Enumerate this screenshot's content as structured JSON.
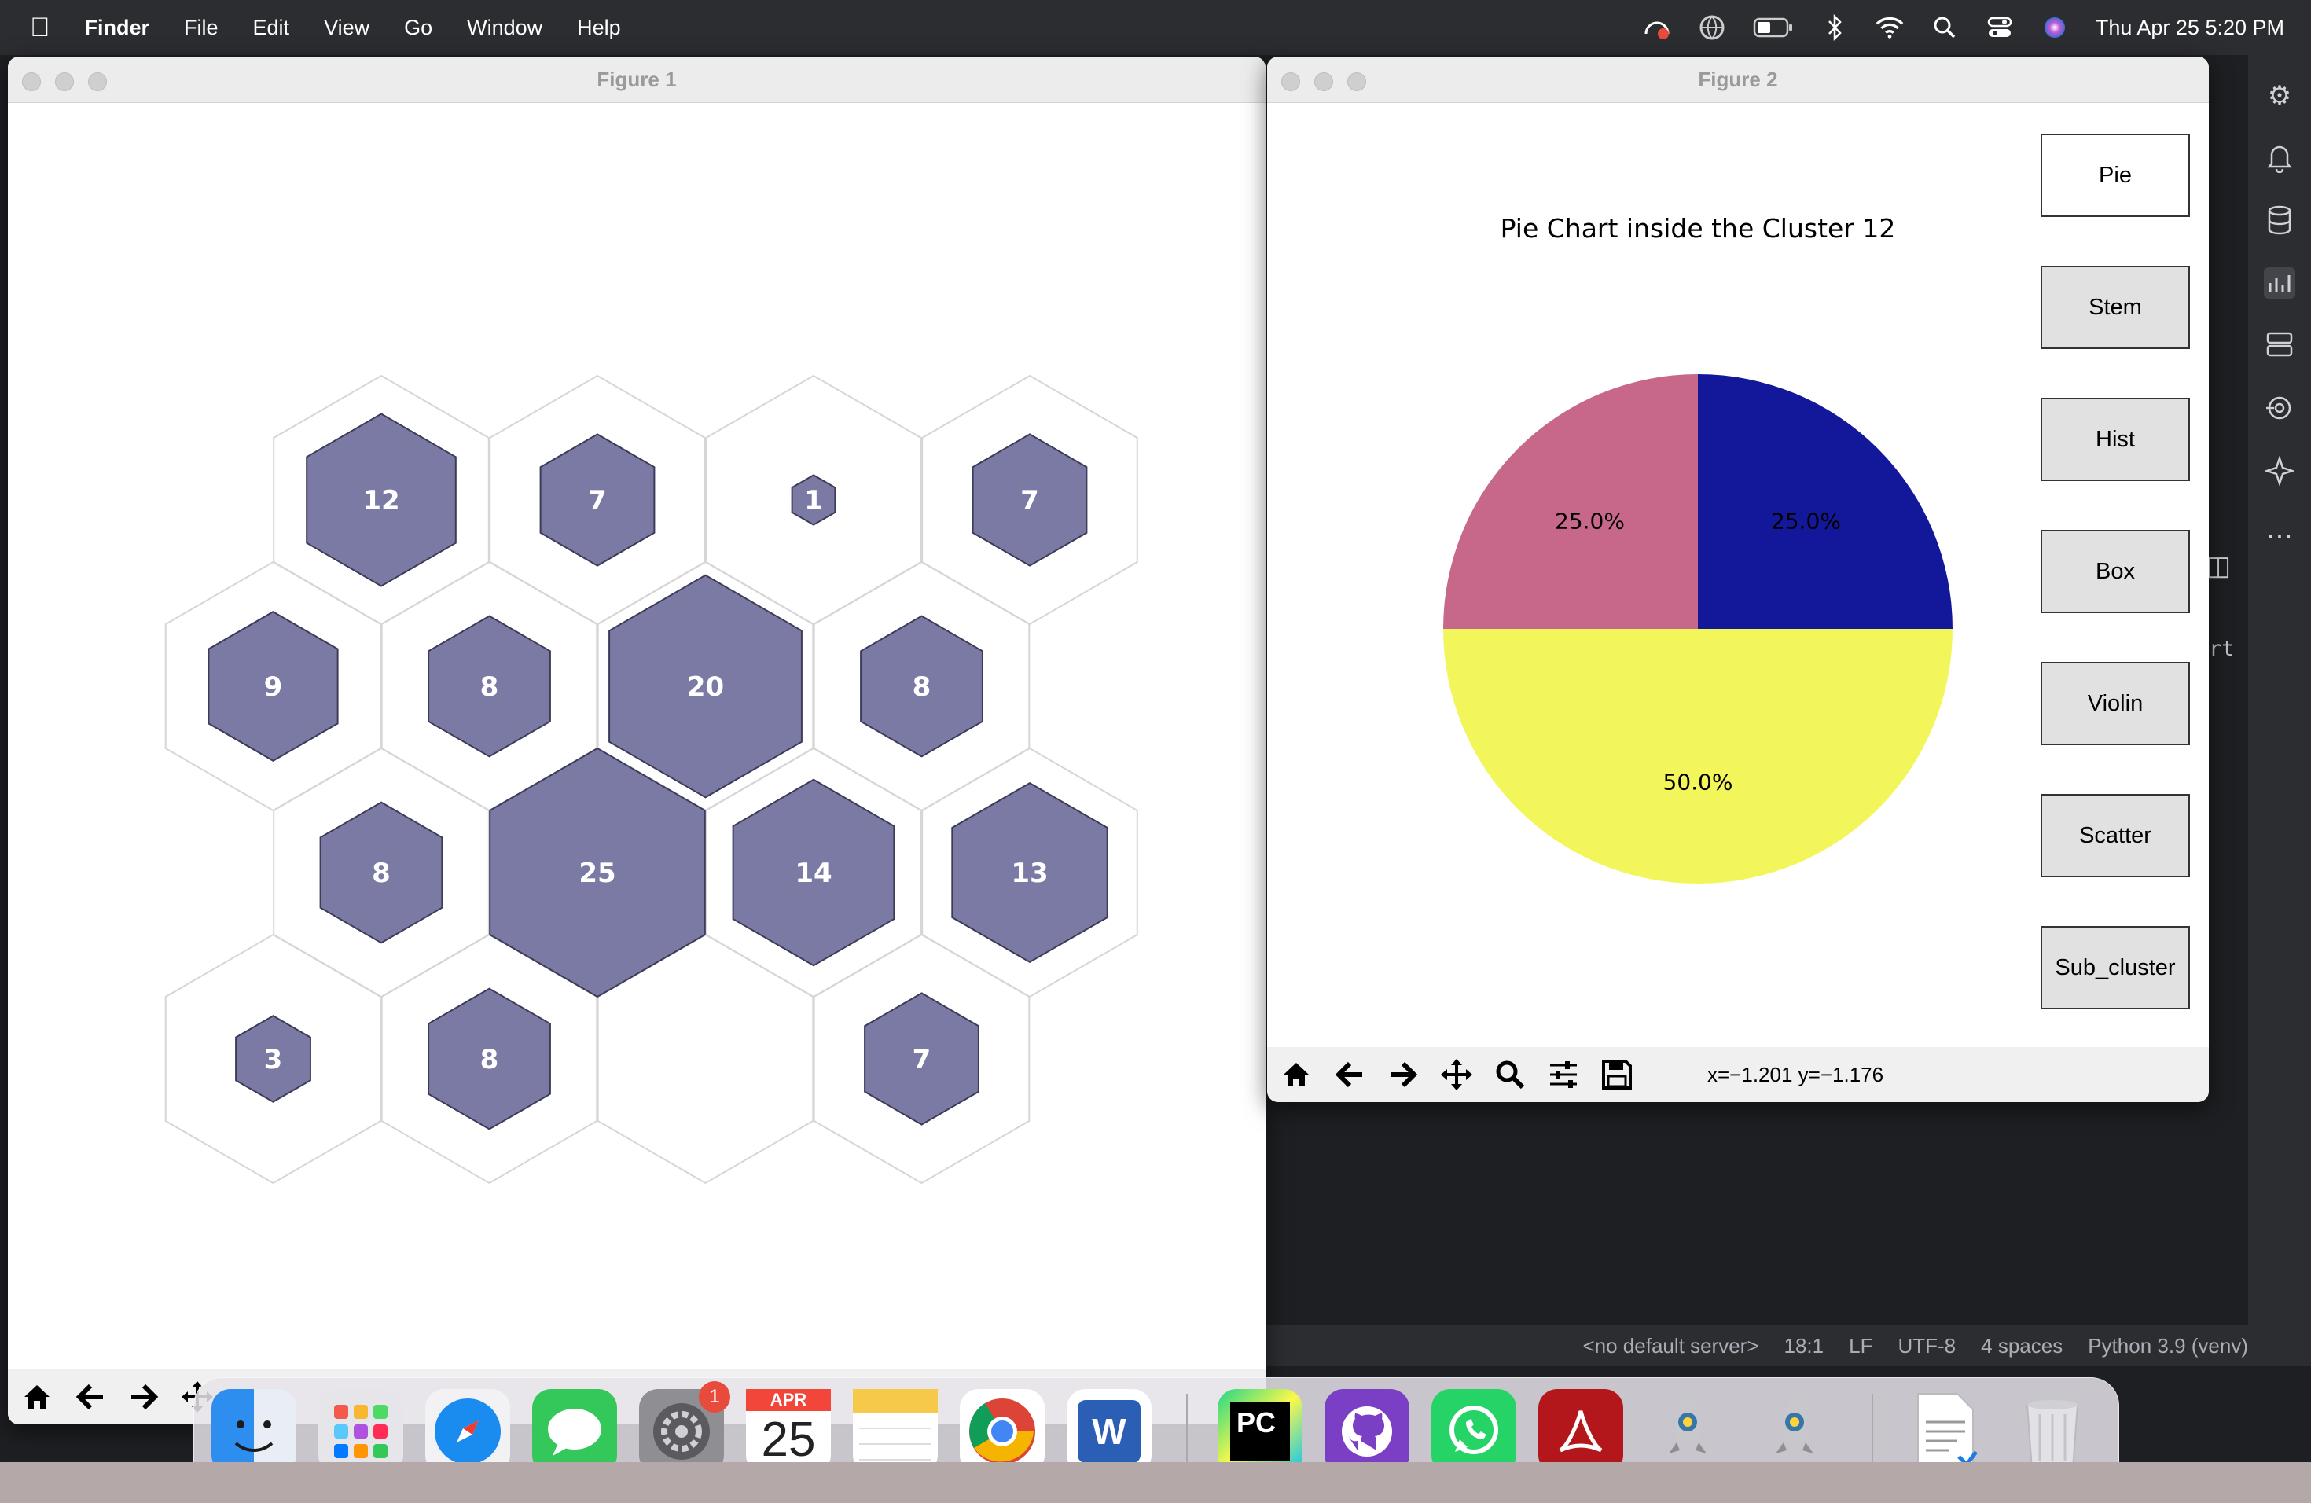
{
  "menubar": {
    "app_name": "Finder",
    "items": [
      "File",
      "Edit",
      "View",
      "Go",
      "Window",
      "Help"
    ],
    "clock": "Thu Apr 25  5:20 PM"
  },
  "figure1": {
    "title": "Figure 1",
    "cluster_counts": [
      {
        "label": "12",
        "value": 12,
        "row": 0,
        "col": 0
      },
      {
        "label": "7",
        "value": 7,
        "row": 0,
        "col": 1
      },
      {
        "label": "1",
        "value": 1,
        "row": 0,
        "col": 2
      },
      {
        "label": "7",
        "value": 7,
        "row": 0,
        "col": 3
      },
      {
        "label": "9",
        "value": 9,
        "row": 1,
        "col": 0
      },
      {
        "label": "8",
        "value": 8,
        "row": 1,
        "col": 1
      },
      {
        "label": "20",
        "value": 20,
        "row": 1,
        "col": 2
      },
      {
        "label": "8",
        "value": 8,
        "row": 1,
        "col": 3
      },
      {
        "label": "8",
        "value": 8,
        "row": 2,
        "col": 0
      },
      {
        "label": "25",
        "value": 25,
        "row": 2,
        "col": 1
      },
      {
        "label": "14",
        "value": 14,
        "row": 2,
        "col": 2
      },
      {
        "label": "13",
        "value": 13,
        "row": 2,
        "col": 3
      },
      {
        "label": "3",
        "value": 3,
        "row": 3,
        "col": 0
      },
      {
        "label": "8",
        "value": 8,
        "row": 3,
        "col": 1
      },
      {
        "label": "",
        "value": 0,
        "row": 3,
        "col": 2
      },
      {
        "label": "7",
        "value": 7,
        "row": 3,
        "col": 3
      }
    ],
    "fill_color": "#7b7aa5"
  },
  "figure2": {
    "title": "Figure 2",
    "chart_data": {
      "type": "pie",
      "title": "Pie Chart inside the Cluster 12",
      "slices": [
        {
          "value": 25.0,
          "label": "25.0%",
          "color": "#13189a"
        },
        {
          "value": 50.0,
          "label": "50.0%",
          "color": "#f2f65a"
        },
        {
          "value": 25.0,
          "label": "25.0%",
          "color": "#c76789"
        }
      ]
    },
    "buttons": [
      "Pie",
      "Stem",
      "Hist",
      "Box",
      "Violin",
      "Scatter",
      "Sub_cluster"
    ],
    "coords": "x=−1.201 y=−1.176"
  },
  "ide_status": {
    "items": [
      "<no default server>",
      "18:1",
      "LF",
      "UTF-8",
      "4 spaces",
      "Python 3.9 (venv)"
    ],
    "partial_text": "rt"
  },
  "dock": {
    "calendar_month": "APR",
    "calendar_day": "25",
    "settings_badge": "1",
    "pycharm_label": "PC",
    "word_label": "W"
  }
}
